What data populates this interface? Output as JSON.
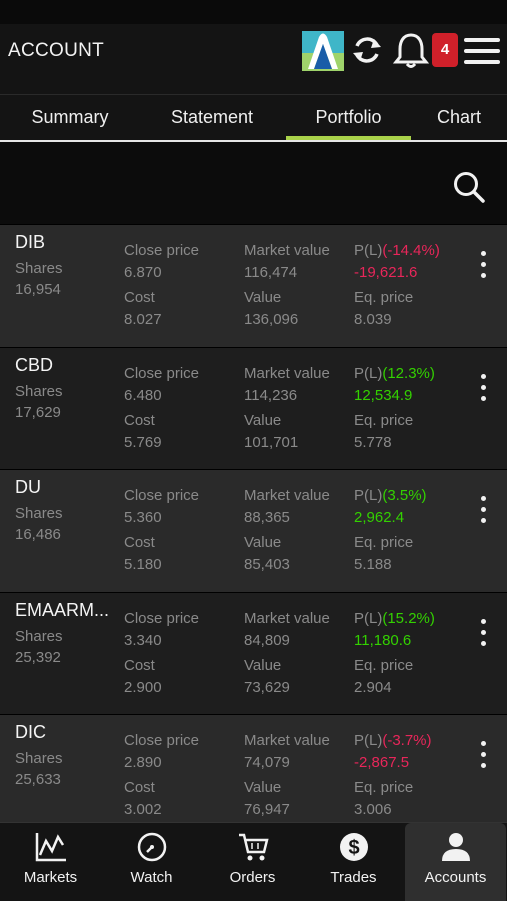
{
  "header": {
    "title": "ACCOUNT",
    "notification_count": "4"
  },
  "tabs": [
    {
      "label": "Summary"
    },
    {
      "label": "Statement"
    },
    {
      "label": "Portfolio"
    },
    {
      "label": "Chart"
    }
  ],
  "active_tab": "Portfolio",
  "labels": {
    "shares": "Shares",
    "close_price": "Close price",
    "market_value": "Market value",
    "cost": "Cost",
    "value": "Value",
    "eq_price": "Eq. price"
  },
  "holdings": [
    {
      "symbol": "DIB",
      "shares": "16,954",
      "close_price": "6.870",
      "market_value": "116,474",
      "pl_prefix": "P(L)",
      "pl_pct": "(-14.4%)",
      "pl_amount": "-19,621.6",
      "cost": "8.027",
      "value": "136,096",
      "eq_price": "8.039",
      "direction": "down"
    },
    {
      "symbol": "CBD",
      "shares": "17,629",
      "close_price": "6.480",
      "market_value": "114,236",
      "pl_prefix": "P(L)",
      "pl_pct": "(12.3%)",
      "pl_amount": "12,534.9",
      "cost": "5.769",
      "value": "101,701",
      "eq_price": "5.778",
      "direction": "up"
    },
    {
      "symbol": "DU",
      "shares": "16,486",
      "close_price": "5.360",
      "market_value": "88,365",
      "pl_prefix": "P(L)",
      "pl_pct": "(3.5%)",
      "pl_amount": "2,962.4",
      "cost": "5.180",
      "value": "85,403",
      "eq_price": "5.188",
      "direction": "up"
    },
    {
      "symbol": "EMAARM...",
      "shares": "25,392",
      "close_price": "3.340",
      "market_value": "84,809",
      "pl_prefix": "P(L)",
      "pl_pct": "(15.2%)",
      "pl_amount": "11,180.6",
      "cost": "2.900",
      "value": "73,629",
      "eq_price": "2.904",
      "direction": "up"
    },
    {
      "symbol": "DIC",
      "shares": "25,633",
      "close_price": "2.890",
      "market_value": "74,079",
      "pl_prefix": "P(L)",
      "pl_pct": "(-3.7%)",
      "pl_amount": "-2,867.5",
      "cost": "3.002",
      "value": "76,947",
      "eq_price": "3.006",
      "direction": "down"
    }
  ],
  "bottom_nav": [
    {
      "label": "Markets",
      "icon": "line-chart-icon"
    },
    {
      "label": "Watch",
      "icon": "clock-icon"
    },
    {
      "label": "Orders",
      "icon": "cart-icon"
    },
    {
      "label": "Trades",
      "icon": "dollar-icon"
    },
    {
      "label": "Accounts",
      "icon": "user-icon"
    }
  ],
  "active_nav": "Accounts",
  "colors": {
    "accent": "#a9d24a",
    "positive": "#33d100",
    "negative": "#e8265a",
    "badge": "#d0202a"
  }
}
